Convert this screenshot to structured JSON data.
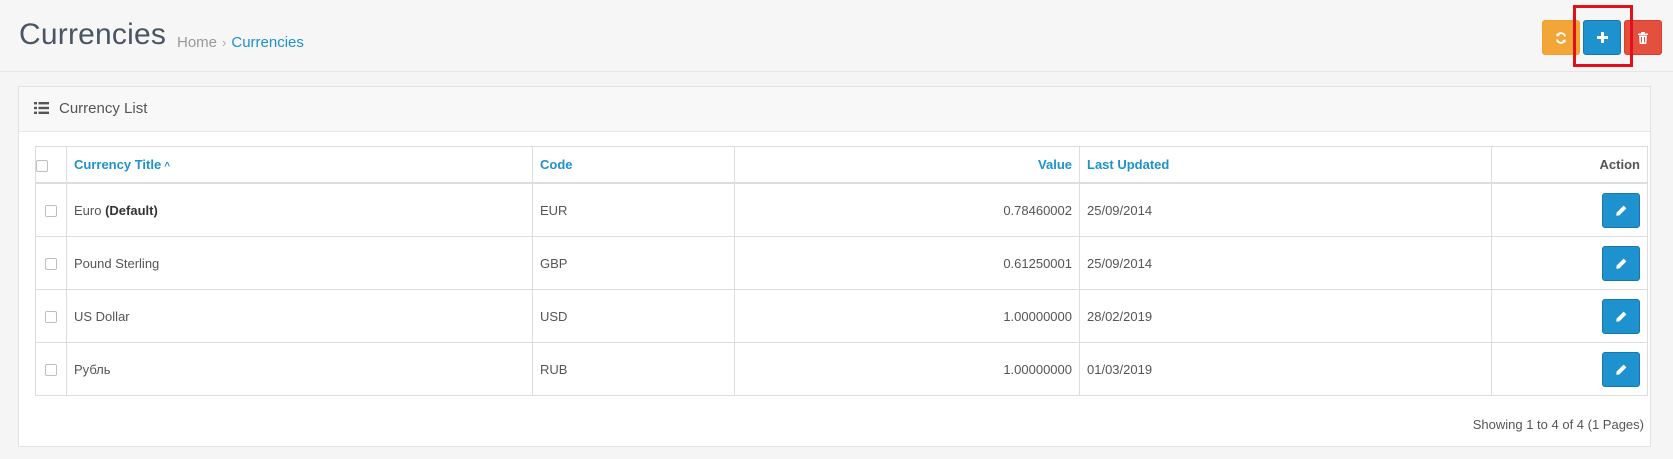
{
  "page": {
    "title": "Currencies",
    "breadcrumbs": [
      {
        "label": "Home"
      },
      {
        "label": "Currencies"
      }
    ],
    "breadcrumb_separator": "›"
  },
  "toolbar": {
    "refresh_icon": "refresh-icon",
    "add_icon": "plus-icon",
    "delete_icon": "trash-icon",
    "colors": {
      "refresh": "#f3a638",
      "add": "#1e91cf",
      "delete": "#e3503e",
      "highlight": "#e3101c"
    }
  },
  "panel": {
    "icon": "list-icon",
    "title": "Currency List"
  },
  "table": {
    "columns": {
      "title": "Currency Title",
      "title_sort_indicator": "^",
      "code": "Code",
      "value": "Value",
      "last_updated": "Last Updated",
      "action": "Action"
    },
    "rows": [
      {
        "title": "Euro",
        "default_label": "(Default)",
        "code": "EUR",
        "value": "0.78460002",
        "last_updated": "25/09/2014"
      },
      {
        "title": "Pound Sterling",
        "default_label": "",
        "code": "GBP",
        "value": "0.61250001",
        "last_updated": "25/09/2014"
      },
      {
        "title": "US Dollar",
        "default_label": "",
        "code": "USD",
        "value": "1.00000000",
        "last_updated": "28/02/2019"
      },
      {
        "title": "Рубль",
        "default_label": "",
        "code": "RUB",
        "value": "1.00000000",
        "last_updated": "01/03/2019"
      }
    ],
    "edit_icon": "pencil-icon"
  },
  "pagination": {
    "summary": "Showing 1 to 4 of 4 (1 Pages)"
  }
}
